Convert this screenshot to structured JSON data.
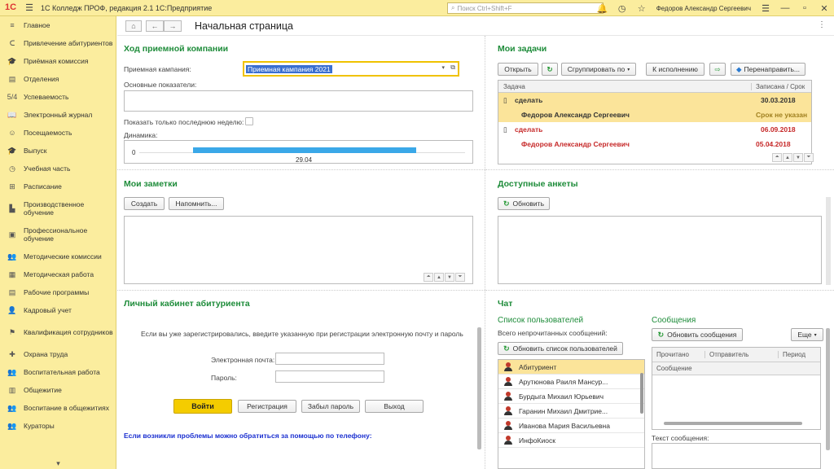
{
  "titlebar": {
    "logo": "1С",
    "title": "1С Колледж ПРОФ, редакция 2.1 1С:Предприятие",
    "search_placeholder": "Поиск Ctrl+Shift+F",
    "user": "Федоров Александр Сергеевич"
  },
  "sidebar": {
    "items": [
      {
        "icon": "≡",
        "label": "Главное"
      },
      {
        "icon": "ᑕ",
        "label": "Привлечение абитуриентов"
      },
      {
        "icon": "🎓",
        "label": "Приёмная комиссия"
      },
      {
        "icon": "▤",
        "label": "Отделения"
      },
      {
        "icon": "5/4",
        "label": "Успеваемость"
      },
      {
        "icon": "📖",
        "label": "Электронный журнал"
      },
      {
        "icon": "☺",
        "label": "Посещаемость"
      },
      {
        "icon": "🎓",
        "label": "Выпуск"
      },
      {
        "icon": "◷",
        "label": "Учебная часть"
      },
      {
        "icon": "⊞",
        "label": "Расписание"
      },
      {
        "icon": "▙",
        "label": "Производственное обучение"
      },
      {
        "icon": "▣",
        "label": "Профессиональное обучение"
      },
      {
        "icon": "👥",
        "label": "Методические комиссии"
      },
      {
        "icon": "▦",
        "label": "Методическая работа"
      },
      {
        "icon": "▤",
        "label": "Рабочие программы"
      },
      {
        "icon": "👤",
        "label": "Кадровый учет"
      },
      {
        "icon": "⚑",
        "label": "Квалификация сотрудников"
      },
      {
        "icon": "✚",
        "label": "Охрана труда"
      },
      {
        "icon": "👥",
        "label": "Воспитательная работа"
      },
      {
        "icon": "▥",
        "label": "Общежитие"
      },
      {
        "icon": "👥",
        "label": "Воспитание в общежитиях"
      },
      {
        "icon": "👥",
        "label": "Кураторы"
      }
    ]
  },
  "page": {
    "title": "Начальная страница"
  },
  "admission": {
    "title": "Ход приемной компании",
    "campaign_label": "Приемная кампания:",
    "campaign_value": "Приемная кампания 2021",
    "indicators_label": "Основные показатели:",
    "last_week_label": "Показать только последнюю неделю:",
    "dynamics_label": "Динамика:",
    "axis_zero": "0",
    "axis_date": "29.04"
  },
  "tasks": {
    "title": "Мои задачи",
    "open_btn": "Открыть",
    "group_btn": "Сгруппировать по",
    "execute_btn": "К исполнению",
    "redirect_btn": "Перенаправить...",
    "col_task": "Задача",
    "col_date": "Записана / Срок",
    "rows": [
      {
        "task": "сделать",
        "date": "30.03.2018"
      },
      {
        "task": "Федоров Александр Сергеевич",
        "date": "Срок не указан"
      },
      {
        "task": "сделать",
        "date": "06.09.2018"
      },
      {
        "task": "Федоров Александр Сергеевич",
        "date": "05.04.2018"
      }
    ]
  },
  "notes": {
    "title": "Мои заметки",
    "create_btn": "Создать",
    "remind_btn": "Напомнить..."
  },
  "surveys": {
    "title": "Доступные анкеты",
    "refresh_btn": "Обновить"
  },
  "cabinet": {
    "title": "Личный кабинет абитуриента",
    "info": "Если вы уже зарегистрировались, введите указанную при регистрации электронную почту и пароль",
    "email_label": "Электронная почта:",
    "password_label": "Пароль:",
    "login_btn": "Войти",
    "register_btn": "Регистрация",
    "forgot_btn": "Забыл пароль",
    "exit_btn": "Выход",
    "help": "Если возникли проблемы можно обратиться за помощью по телефону:"
  },
  "chat": {
    "title": "Чат",
    "users_title": "Список пользователей",
    "unread_label": "Всего непрочитанных сообщений:",
    "refresh_users_btn": "Обновить список пользователей",
    "users": [
      "Абитуриент",
      "Арутюнова Раиля Мансур...",
      "Бурдыга Михаил Юрьевич",
      "Гаранин Михаил Дмитрие...",
      "Иванова Мария Васильевна",
      "ИнфоКиоск"
    ],
    "messages_title": "Сообщения",
    "refresh_messages_btn": "Обновить сообщения",
    "more_btn": "Еще",
    "col_read": "Прочитано",
    "col_sender": "Отправитель",
    "col_period": "Период",
    "col_message": "Сообщение",
    "message_text_label": "Текст сообщения:"
  },
  "colors": {
    "accent_green": "#1e8c3a",
    "sidebar_yellow": "#fbed9e",
    "button_yellow": "#f4cc00",
    "date_red": "#c62828"
  }
}
